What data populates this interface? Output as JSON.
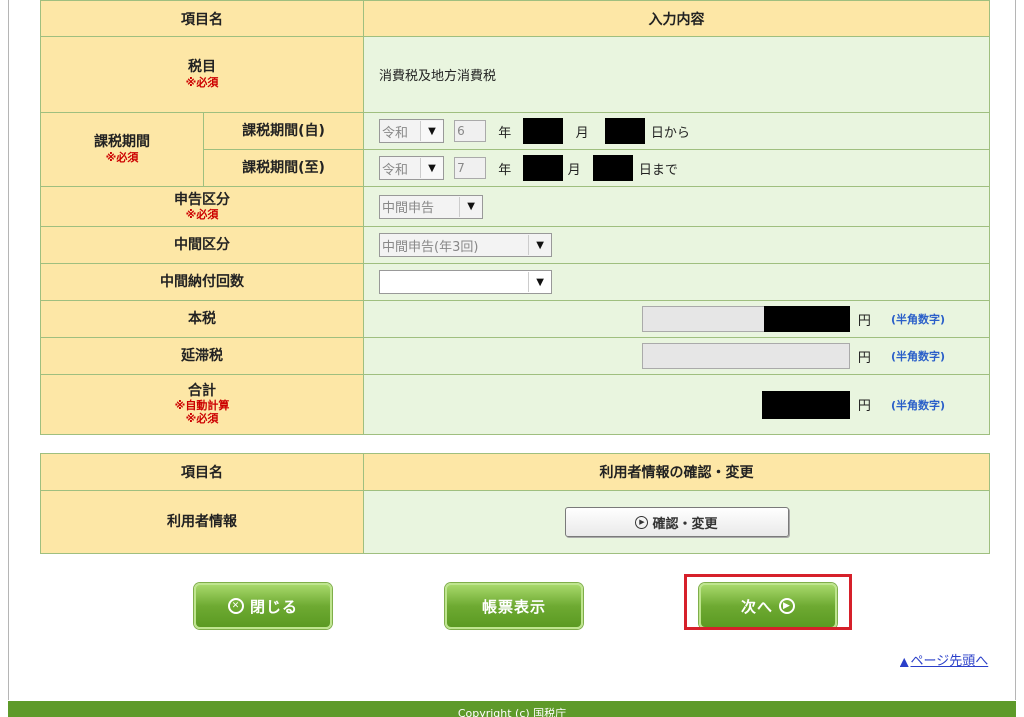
{
  "form": {
    "header": {
      "item": "項目名",
      "input": "入力内容"
    },
    "tax_item": {
      "label": "税目",
      "required": "※必須",
      "value": "消費税及地方消費税"
    },
    "period": {
      "label": "課税期間",
      "required": "※必須",
      "from": {
        "label": "課税期間(自)",
        "era": "令和",
        "year": "6",
        "year_unit": "年",
        "month_unit": "月",
        "day_unit": "日から"
      },
      "to": {
        "label": "課税期間(至)",
        "era": "令和",
        "year": "7",
        "year_unit": "年",
        "month_unit": "月",
        "day_unit": "日まで"
      }
    },
    "report_type": {
      "label": "申告区分",
      "required": "※必須",
      "value": "中間申告"
    },
    "interim_type": {
      "label": "中間区分",
      "value": "中間申告(年3回)"
    },
    "interim_count": {
      "label": "中間納付回数",
      "value": ""
    },
    "main_tax": {
      "label": "本税",
      "unit": "円",
      "hint": "(半角数字)"
    },
    "delinquent_tax": {
      "label": "延滞税",
      "unit": "円",
      "hint": "(半角数字)"
    },
    "total": {
      "label": "合計",
      "auto": "※自動計算",
      "required": "※必須",
      "unit": "円",
      "hint": "(半角数字)"
    }
  },
  "user": {
    "header": {
      "item": "項目名",
      "action": "利用者情報の確認・変更"
    },
    "label": "利用者情報",
    "button": "確認・変更"
  },
  "buttons": {
    "close": "閉じる",
    "display": "帳票表示",
    "next": "次へ"
  },
  "page_top": "ページ先頭へ",
  "footer": "Copyright (c) 国税庁",
  "colors": {
    "header_bg": "#fde7a6",
    "value_bg": "#e9f5df",
    "accent": "#6eaa32",
    "highlight": "#d6202a",
    "hint": "#2a5fc9"
  },
  "icons": {
    "close": "close-circle-icon",
    "next": "play-circle-icon",
    "confirm": "play-circle-icon",
    "top": "up-triangle-icon"
  }
}
